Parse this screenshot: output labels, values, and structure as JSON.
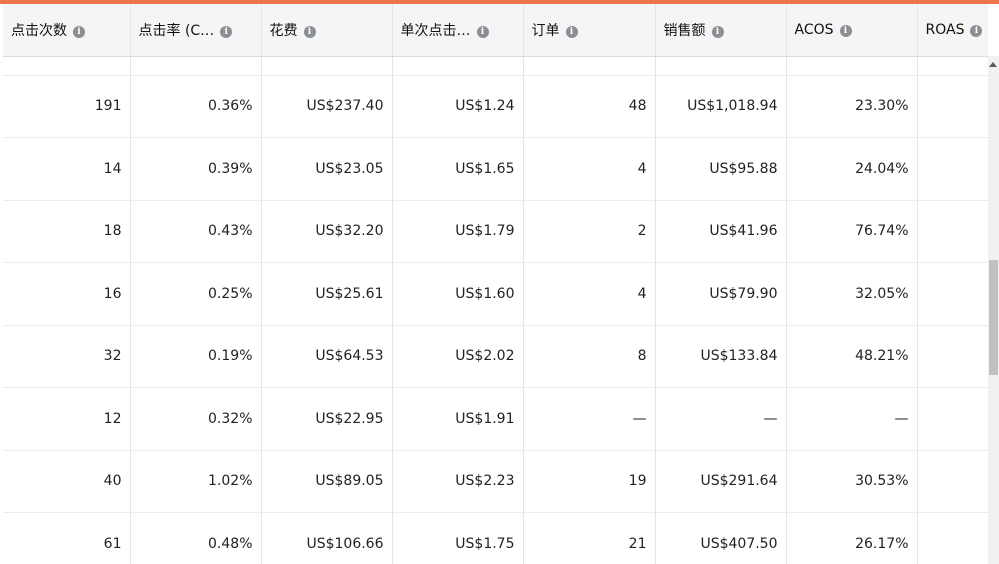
{
  "columns": [
    "点击次数",
    "点击率 (C…",
    "花费",
    "单次点击…",
    "订单",
    "销售额",
    "ACOS",
    "ROAS"
  ],
  "rows": [
    [
      "191",
      "0.36%",
      "US$237.40",
      "US$1.24",
      "48",
      "US$1,018.94",
      "23.30%",
      ""
    ],
    [
      "14",
      "0.39%",
      "US$23.05",
      "US$1.65",
      "4",
      "US$95.88",
      "24.04%",
      ""
    ],
    [
      "18",
      "0.43%",
      "US$32.20",
      "US$1.79",
      "2",
      "US$41.96",
      "76.74%",
      ""
    ],
    [
      "16",
      "0.25%",
      "US$25.61",
      "US$1.60",
      "4",
      "US$79.90",
      "32.05%",
      ""
    ],
    [
      "32",
      "0.19%",
      "US$64.53",
      "US$2.02",
      "8",
      "US$133.84",
      "48.21%",
      ""
    ],
    [
      "12",
      "0.32%",
      "US$22.95",
      "US$1.91",
      "—",
      "—",
      "—",
      ""
    ],
    [
      "40",
      "1.02%",
      "US$89.05",
      "US$2.23",
      "19",
      "US$291.64",
      "30.53%",
      ""
    ],
    [
      "61",
      "0.48%",
      "US$106.66",
      "US$1.75",
      "21",
      "US$407.50",
      "26.17%",
      ""
    ]
  ],
  "colors": {
    "accent_bar": "#f0744a",
    "header_bg": "#f5f5f5",
    "info_icon": "#8a8f96"
  },
  "icons": {
    "header_info": "info-icon",
    "scroll_up": "chevron-up-icon"
  }
}
